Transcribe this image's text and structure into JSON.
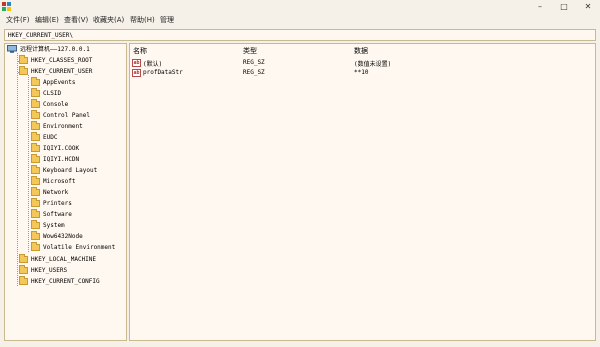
{
  "window": {
    "title_icon": "registry-editor-icon",
    "controls": [
      "minimize",
      "maximize",
      "close"
    ]
  },
  "menu": {
    "items": [
      "文件(F)",
      "编辑(E)",
      "查看(V)",
      "收藏夹(A)",
      "帮助(H)",
      "管理"
    ]
  },
  "address": {
    "path": "HKEY_CURRENT_USER\\"
  },
  "tree": {
    "root": {
      "label": "远程计算机——127.0.0.1",
      "icon": "computer-icon"
    },
    "hives": [
      {
        "label": "HKEY_CLASSES_ROOT"
      },
      {
        "label": "HKEY_CURRENT_USER",
        "expanded": true,
        "children": [
          "AppEvents",
          "CLSID",
          "Console",
          "Control Panel",
          "Environment",
          "EUDC",
          "IQIYI.COOK",
          "IQIYI.HCDN",
          "Keyboard Layout",
          "Microsoft",
          "Network",
          "Printers",
          "Software",
          "System",
          "Wow6432Node",
          "Volatile Environment"
        ]
      },
      {
        "label": "HKEY_LOCAL_MACHINE"
      },
      {
        "label": "HKEY_USERS"
      },
      {
        "label": "HKEY_CURRENT_CONFIG"
      }
    ]
  },
  "list": {
    "columns": [
      "名称",
      "类型",
      "数据"
    ],
    "rows": [
      {
        "icon": "string-value-icon",
        "name": "(默认)",
        "type": "REG_SZ",
        "data": "(数值未设置)"
      },
      {
        "icon": "string-value-icon",
        "name": "profDataStr",
        "type": "REG_SZ",
        "data": "**10"
      }
    ]
  },
  "colors": {
    "background": "#f5f1e9",
    "pane": "#fff8f0",
    "folder": "#f3c75a",
    "border": "#c9b98f"
  }
}
